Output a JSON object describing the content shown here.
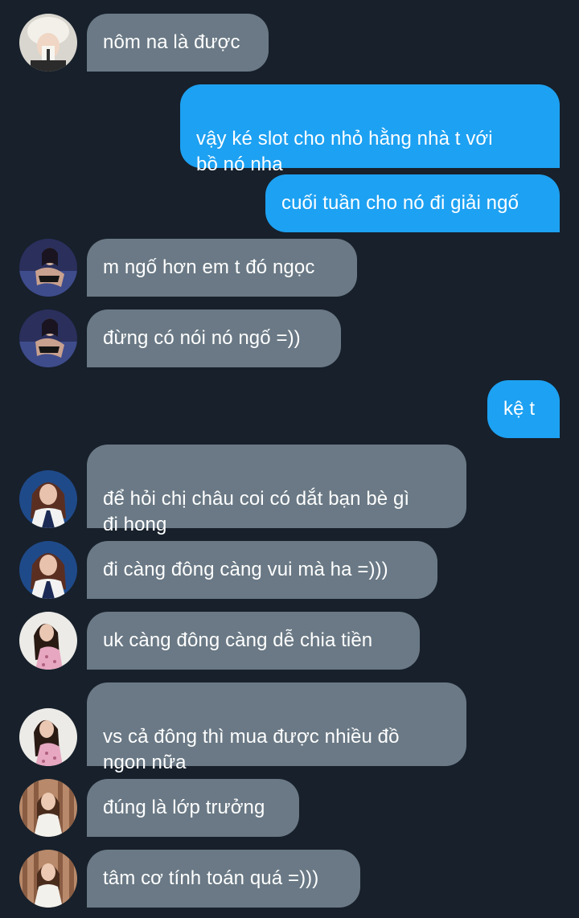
{
  "messages": [
    {
      "id": "m1",
      "side": "in",
      "avatar": "user-a-avatar",
      "text": "nôm na là được"
    },
    {
      "id": "m2",
      "side": "out",
      "text": "vậy ké slot cho nhỏ hằng nhà t với\nbồ nó nha"
    },
    {
      "id": "m3",
      "side": "out",
      "text": "cuối tuần cho nó đi giải ngố"
    },
    {
      "id": "m4",
      "side": "in",
      "avatar": "user-b-avatar",
      "text": "m ngố hơn em t đó ngọc"
    },
    {
      "id": "m5",
      "side": "in",
      "avatar": "user-b-avatar",
      "text": "đừng có nói nó ngố =))"
    },
    {
      "id": "m6",
      "side": "out",
      "text": "kệ t"
    },
    {
      "id": "m7",
      "side": "in",
      "avatar": "user-c-avatar",
      "text": "để hỏi chị châu coi có dắt bạn bè gì\nđi hong"
    },
    {
      "id": "m8",
      "side": "in",
      "avatar": "user-c-avatar",
      "text": "đi càng đông càng vui mà ha =)))"
    },
    {
      "id": "m9",
      "side": "in",
      "avatar": "user-d-avatar",
      "text": "uk càng đông càng dễ chia tiền"
    },
    {
      "id": "m10",
      "side": "in",
      "avatar": "user-d-avatar",
      "text": "vs cả đông thì mua được nhiều đồ\nngon nữa"
    },
    {
      "id": "m11",
      "side": "in",
      "avatar": "user-e-avatar",
      "text": "đúng là lớp trưởng"
    },
    {
      "id": "m12",
      "side": "in",
      "avatar": "user-e-avatar",
      "text": "tâm cơ tính toán quá =)))"
    }
  ],
  "colors": {
    "background": "#17202b",
    "incoming_bubble": "#6a7985",
    "outgoing_bubble": "#1da1f2",
    "text": "#ffffff"
  }
}
